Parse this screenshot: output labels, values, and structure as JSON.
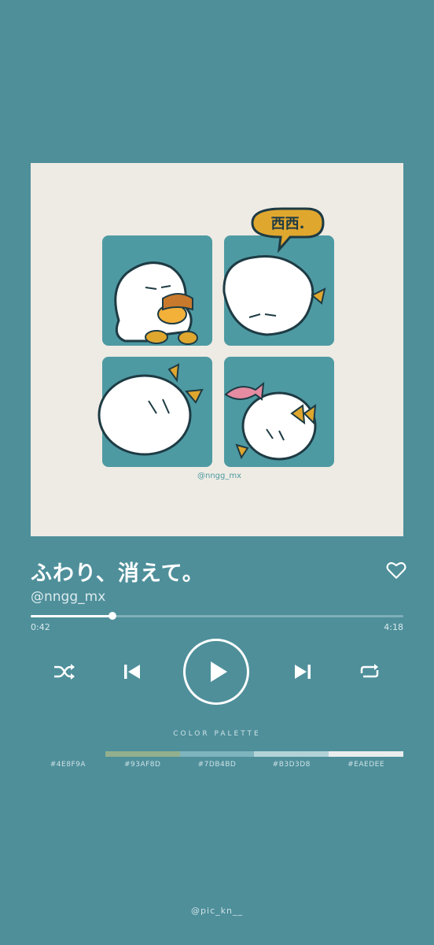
{
  "track": {
    "title": "ふわり、消えて。",
    "artist": "@nngg_mx",
    "current_time": "0:42",
    "total_time": "4:18",
    "progress": 0.22,
    "liked": false
  },
  "artwork": {
    "speech_text": "西西.",
    "signature": "@nngg_mx",
    "panel_color": "#4E9AA3",
    "background_color": "#EEEBE4"
  },
  "controls": {
    "shuffle_icon": "shuffle-icon",
    "previous_icon": "skip-previous-icon",
    "play_icon": "play-icon",
    "next_icon": "skip-next-icon",
    "repeat_icon": "repeat-icon",
    "like_icon": "heart-icon"
  },
  "palette": {
    "label": "COLOR PALETTE",
    "colors": [
      "#4E8F9A",
      "#93AF8D",
      "#7DB4BD",
      "#B3D3D8",
      "#EAEDEE"
    ],
    "codes": [
      "#4E8F9A",
      "#93AF8D",
      "#7DB4BD",
      "#B3D3D8",
      "#EAEDEE"
    ]
  },
  "credit": "@pic_kn__"
}
